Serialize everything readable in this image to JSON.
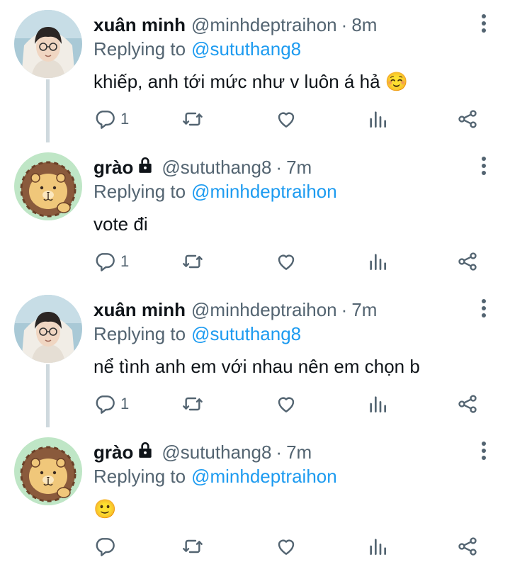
{
  "tweets": [
    {
      "display_name": "xuân minh",
      "locked": false,
      "handle": "@minhdeptraihon",
      "time": "8m",
      "replying_label": "Replying to",
      "replying_to": "@sututhang8",
      "text": "khiếp, anh tới mức như v luôn á hả ☺️",
      "reply_count": "1",
      "avatar": "person-avatar"
    },
    {
      "display_name": "grào",
      "locked": true,
      "handle": "@sututhang8",
      "time": "7m",
      "replying_label": "Replying to",
      "replying_to": "@minhdeptraihon",
      "text": "vote đi",
      "reply_count": "1",
      "avatar": "lion-avatar"
    },
    {
      "display_name": "xuân minh",
      "locked": false,
      "handle": "@minhdeptraihon",
      "time": "7m",
      "replying_label": "Replying to",
      "replying_to": "@sututhang8",
      "text": "nể tình anh em với nhau nên em chọn b",
      "reply_count": "1",
      "avatar": "person-avatar"
    },
    {
      "display_name": "grào",
      "locked": true,
      "handle": "@sututhang8",
      "time": "7m",
      "replying_label": "Replying to",
      "replying_to": "@minhdeptraihon",
      "text": "🙂",
      "reply_count": "",
      "avatar": "lion-avatar"
    }
  ],
  "icons": {
    "reply": "reply-icon",
    "retweet": "retweet-icon",
    "like": "heart-icon",
    "views": "stats-icon",
    "share": "share-icon",
    "more": "more-options-icon",
    "lock": "lock-icon"
  },
  "colors": {
    "text": "#0f1419",
    "muted": "#536471",
    "link": "#1d9bf0",
    "thread_line": "#cfd9de"
  }
}
